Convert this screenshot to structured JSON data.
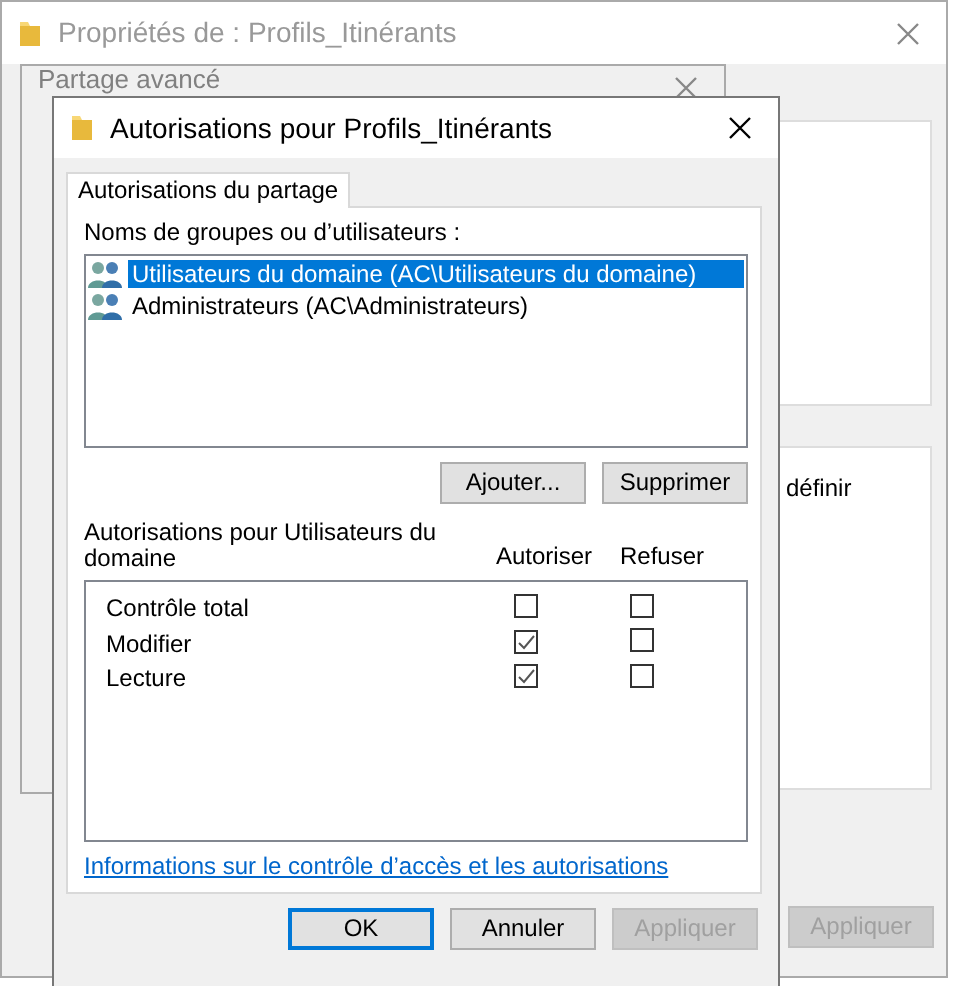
{
  "background_window": {
    "title": "Propriétés de : Profils_Itinérants",
    "partial_text": "définir",
    "apply_button": {
      "label": "Appliquer",
      "disabled": true
    }
  },
  "middle_window": {
    "title": "Partage avancé"
  },
  "dialog": {
    "title": "Autorisations pour Profils_Itinérants",
    "tabs": [
      {
        "label": "Autorisations du partage",
        "selected": true
      }
    ],
    "groups_label": "Noms de groupes ou d’utilisateurs :",
    "groups": [
      {
        "name": "Utilisateurs du domaine (AC\\Utilisateurs du domaine)",
        "selected": true
      },
      {
        "name": "Administrateurs (AC\\Administrateurs)",
        "selected": false
      }
    ],
    "add_button": "Ajouter...",
    "remove_button": "Supprimer",
    "permissions_label": "Autorisations pour Utilisateurs du domaine",
    "allow_header": "Autoriser",
    "deny_header": "Refuser",
    "permissions": [
      {
        "name": "Contrôle total",
        "allow": false,
        "deny": false
      },
      {
        "name": "Modifier",
        "allow": true,
        "deny": false
      },
      {
        "name": "Lecture",
        "allow": true,
        "deny": false
      }
    ],
    "help_link": "Informations sur le contrôle d’accès et les autorisations",
    "buttons": [
      {
        "label": "OK",
        "default": true,
        "disabled": false
      },
      {
        "label": "Annuler",
        "default": false,
        "disabled": false
      },
      {
        "label": "Appliquer",
        "default": false,
        "disabled": true
      }
    ]
  }
}
